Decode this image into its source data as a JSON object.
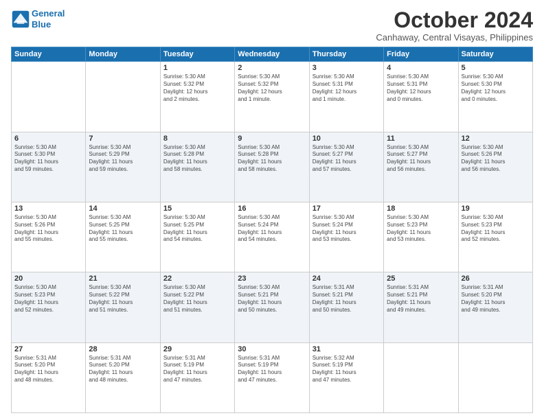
{
  "header": {
    "logo_line1": "General",
    "logo_line2": "Blue",
    "month": "October 2024",
    "location": "Canhaway, Central Visayas, Philippines"
  },
  "days_of_week": [
    "Sunday",
    "Monday",
    "Tuesday",
    "Wednesday",
    "Thursday",
    "Friday",
    "Saturday"
  ],
  "weeks": [
    [
      {
        "day": "",
        "content": ""
      },
      {
        "day": "",
        "content": ""
      },
      {
        "day": "1",
        "content": "Sunrise: 5:30 AM\nSunset: 5:32 PM\nDaylight: 12 hours\nand 2 minutes."
      },
      {
        "day": "2",
        "content": "Sunrise: 5:30 AM\nSunset: 5:32 PM\nDaylight: 12 hours\nand 1 minute."
      },
      {
        "day": "3",
        "content": "Sunrise: 5:30 AM\nSunset: 5:31 PM\nDaylight: 12 hours\nand 1 minute."
      },
      {
        "day": "4",
        "content": "Sunrise: 5:30 AM\nSunset: 5:31 PM\nDaylight: 12 hours\nand 0 minutes."
      },
      {
        "day": "5",
        "content": "Sunrise: 5:30 AM\nSunset: 5:30 PM\nDaylight: 12 hours\nand 0 minutes."
      }
    ],
    [
      {
        "day": "6",
        "content": "Sunrise: 5:30 AM\nSunset: 5:30 PM\nDaylight: 11 hours\nand 59 minutes."
      },
      {
        "day": "7",
        "content": "Sunrise: 5:30 AM\nSunset: 5:29 PM\nDaylight: 11 hours\nand 59 minutes."
      },
      {
        "day": "8",
        "content": "Sunrise: 5:30 AM\nSunset: 5:28 PM\nDaylight: 11 hours\nand 58 minutes."
      },
      {
        "day": "9",
        "content": "Sunrise: 5:30 AM\nSunset: 5:28 PM\nDaylight: 11 hours\nand 58 minutes."
      },
      {
        "day": "10",
        "content": "Sunrise: 5:30 AM\nSunset: 5:27 PM\nDaylight: 11 hours\nand 57 minutes."
      },
      {
        "day": "11",
        "content": "Sunrise: 5:30 AM\nSunset: 5:27 PM\nDaylight: 11 hours\nand 56 minutes."
      },
      {
        "day": "12",
        "content": "Sunrise: 5:30 AM\nSunset: 5:26 PM\nDaylight: 11 hours\nand 56 minutes."
      }
    ],
    [
      {
        "day": "13",
        "content": "Sunrise: 5:30 AM\nSunset: 5:26 PM\nDaylight: 11 hours\nand 55 minutes."
      },
      {
        "day": "14",
        "content": "Sunrise: 5:30 AM\nSunset: 5:25 PM\nDaylight: 11 hours\nand 55 minutes."
      },
      {
        "day": "15",
        "content": "Sunrise: 5:30 AM\nSunset: 5:25 PM\nDaylight: 11 hours\nand 54 minutes."
      },
      {
        "day": "16",
        "content": "Sunrise: 5:30 AM\nSunset: 5:24 PM\nDaylight: 11 hours\nand 54 minutes."
      },
      {
        "day": "17",
        "content": "Sunrise: 5:30 AM\nSunset: 5:24 PM\nDaylight: 11 hours\nand 53 minutes."
      },
      {
        "day": "18",
        "content": "Sunrise: 5:30 AM\nSunset: 5:23 PM\nDaylight: 11 hours\nand 53 minutes."
      },
      {
        "day": "19",
        "content": "Sunrise: 5:30 AM\nSunset: 5:23 PM\nDaylight: 11 hours\nand 52 minutes."
      }
    ],
    [
      {
        "day": "20",
        "content": "Sunrise: 5:30 AM\nSunset: 5:23 PM\nDaylight: 11 hours\nand 52 minutes."
      },
      {
        "day": "21",
        "content": "Sunrise: 5:30 AM\nSunset: 5:22 PM\nDaylight: 11 hours\nand 51 minutes."
      },
      {
        "day": "22",
        "content": "Sunrise: 5:30 AM\nSunset: 5:22 PM\nDaylight: 11 hours\nand 51 minutes."
      },
      {
        "day": "23",
        "content": "Sunrise: 5:30 AM\nSunset: 5:21 PM\nDaylight: 11 hours\nand 50 minutes."
      },
      {
        "day": "24",
        "content": "Sunrise: 5:31 AM\nSunset: 5:21 PM\nDaylight: 11 hours\nand 50 minutes."
      },
      {
        "day": "25",
        "content": "Sunrise: 5:31 AM\nSunset: 5:21 PM\nDaylight: 11 hours\nand 49 minutes."
      },
      {
        "day": "26",
        "content": "Sunrise: 5:31 AM\nSunset: 5:20 PM\nDaylight: 11 hours\nand 49 minutes."
      }
    ],
    [
      {
        "day": "27",
        "content": "Sunrise: 5:31 AM\nSunset: 5:20 PM\nDaylight: 11 hours\nand 48 minutes."
      },
      {
        "day": "28",
        "content": "Sunrise: 5:31 AM\nSunset: 5:20 PM\nDaylight: 11 hours\nand 48 minutes."
      },
      {
        "day": "29",
        "content": "Sunrise: 5:31 AM\nSunset: 5:19 PM\nDaylight: 11 hours\nand 47 minutes."
      },
      {
        "day": "30",
        "content": "Sunrise: 5:31 AM\nSunset: 5:19 PM\nDaylight: 11 hours\nand 47 minutes."
      },
      {
        "day": "31",
        "content": "Sunrise: 5:32 AM\nSunset: 5:19 PM\nDaylight: 11 hours\nand 47 minutes."
      },
      {
        "day": "",
        "content": ""
      },
      {
        "day": "",
        "content": ""
      }
    ]
  ]
}
